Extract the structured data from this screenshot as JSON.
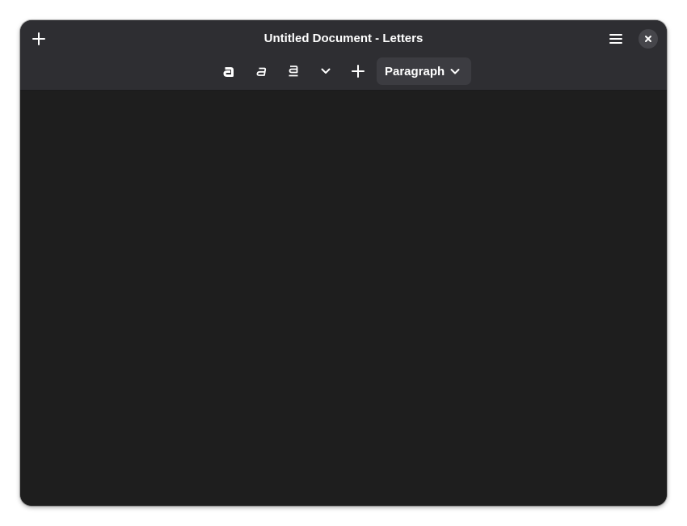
{
  "window": {
    "title": "Untitled Document - Letters"
  },
  "headerbar": {
    "new_icon": "plus-icon",
    "menu_icon": "hamburger-menu-icon",
    "close_icon": "close-icon"
  },
  "toolbar": {
    "bold_icon": "bold-icon",
    "italic_icon": "italic-icon",
    "underline_icon": "underline-icon",
    "more_icon": "chevron-down-icon",
    "insert_icon": "plus-icon",
    "paragraph_style": "Paragraph"
  },
  "editor": {
    "content": ""
  },
  "colors": {
    "headerbar": "#2e2e32",
    "editor_bg": "#1e1e1e",
    "button_bg": "#3c3c41",
    "text": "#ffffff"
  }
}
